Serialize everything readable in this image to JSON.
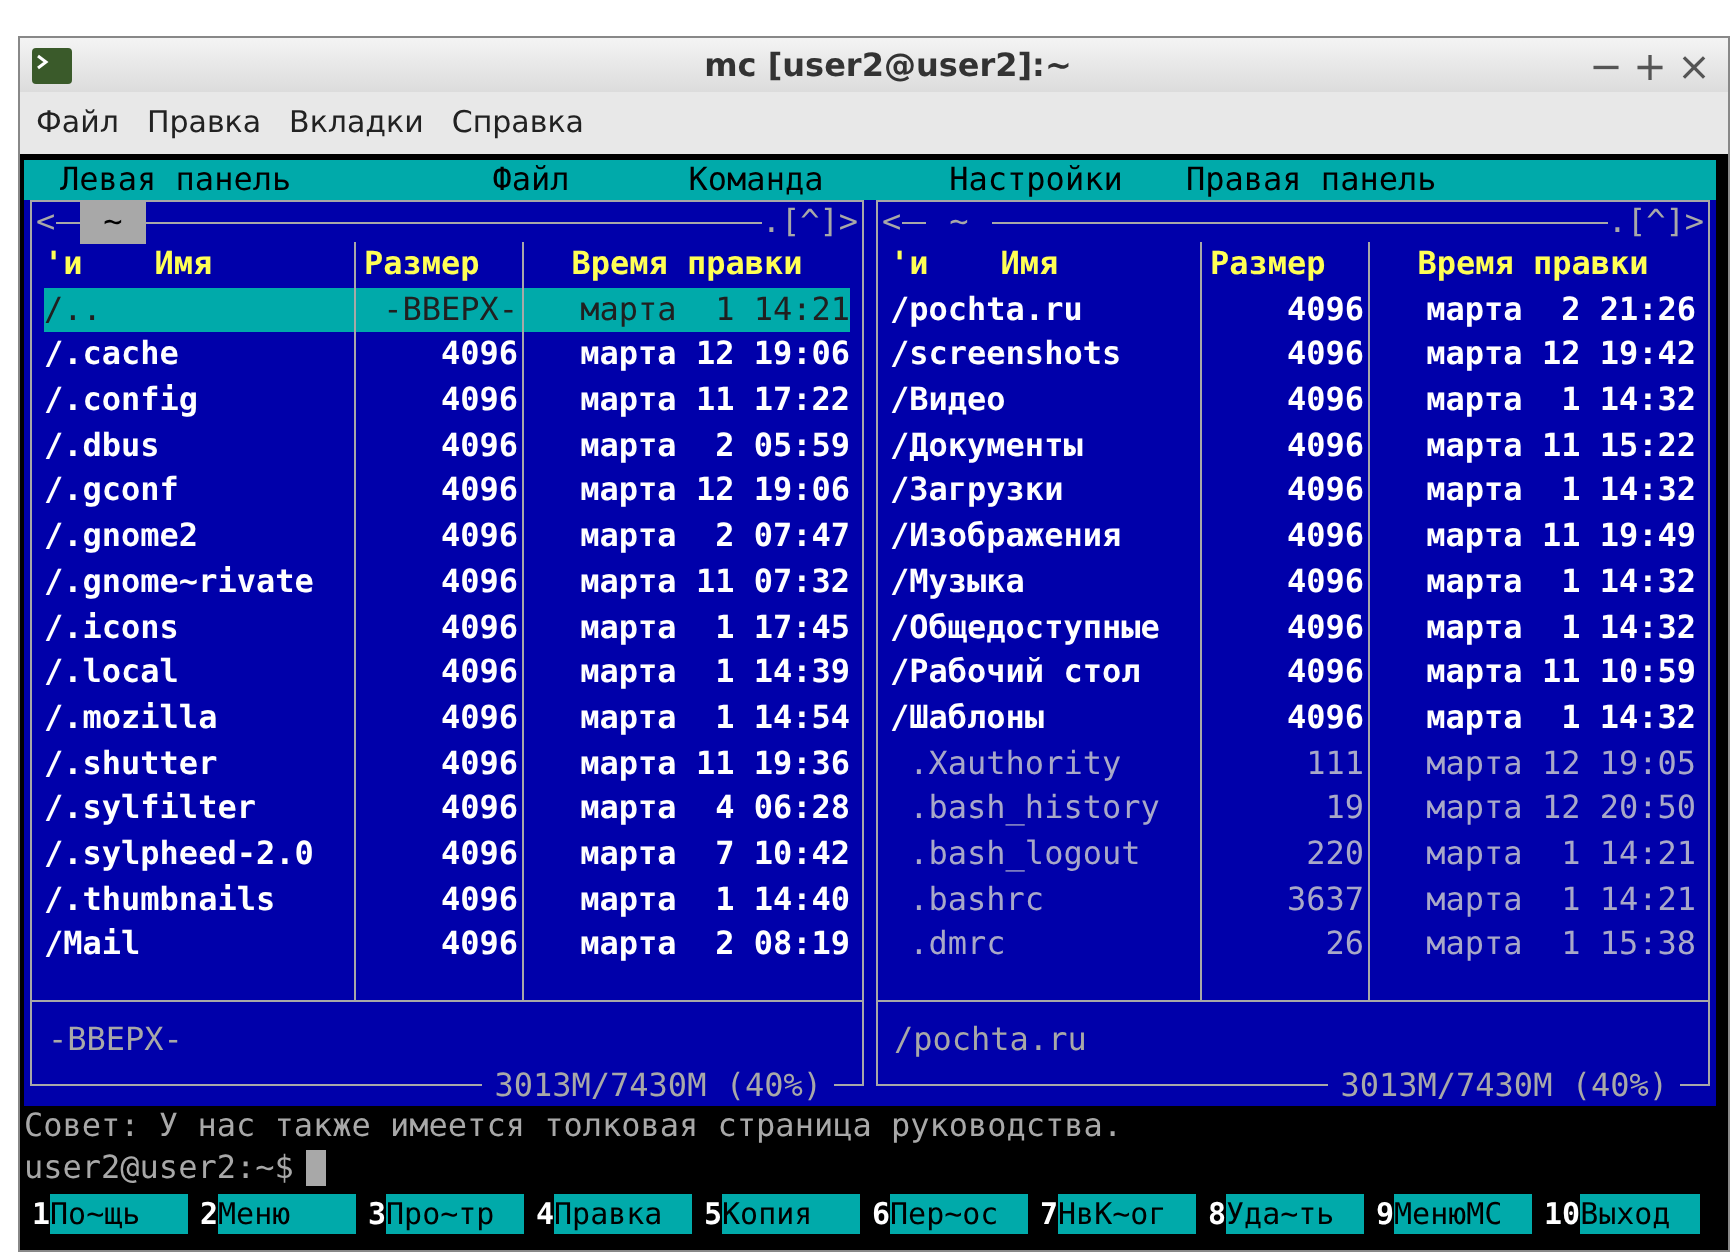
{
  "window": {
    "title": "mc [user2@user2]:~",
    "controls": [
      "−",
      "+",
      "×"
    ]
  },
  "menu": [
    "Файл",
    "Правка",
    "Вкладки",
    "Справка"
  ],
  "mc_menu": [
    "Левая панель",
    "Файл",
    "Команда",
    "Настройки",
    "Правая панель"
  ],
  "panels": [
    {
      "active": true,
      "left_mark": "<",
      "dir": "~",
      "history": ".[^]>",
      "columns": [
        "'и",
        "Имя",
        "Размер",
        "Время правки"
      ],
      "rows": [
        {
          "kind": "up",
          "name": "/..",
          "size": "-ВВЕРХ-",
          "time": "марта  1 14:21",
          "selected": true
        },
        {
          "kind": "dir",
          "name": "/.cache",
          "size": "4096",
          "time": "марта 12 19:06",
          "selected": false
        },
        {
          "kind": "dir",
          "name": "/.config",
          "size": "4096",
          "time": "марта 11 17:22",
          "selected": false
        },
        {
          "kind": "dir",
          "name": "/.dbus",
          "size": "4096",
          "time": "марта  2 05:59",
          "selected": false
        },
        {
          "kind": "dir",
          "name": "/.gconf",
          "size": "4096",
          "time": "марта 12 19:06",
          "selected": false
        },
        {
          "kind": "dir",
          "name": "/.gnome2",
          "size": "4096",
          "time": "марта  2 07:47",
          "selected": false
        },
        {
          "kind": "dir",
          "name": "/.gnome~rivate",
          "size": "4096",
          "time": "марта 11 07:32",
          "selected": false
        },
        {
          "kind": "dir",
          "name": "/.icons",
          "size": "4096",
          "time": "марта  1 17:45",
          "selected": false
        },
        {
          "kind": "dir",
          "name": "/.local",
          "size": "4096",
          "time": "марта  1 14:39",
          "selected": false
        },
        {
          "kind": "dir",
          "name": "/.mozilla",
          "size": "4096",
          "time": "марта  1 14:54",
          "selected": false
        },
        {
          "kind": "dir",
          "name": "/.shutter",
          "size": "4096",
          "time": "марта 11 19:36",
          "selected": false
        },
        {
          "kind": "dir",
          "name": "/.sylfilter",
          "size": "4096",
          "time": "марта  4 06:28",
          "selected": false
        },
        {
          "kind": "dir",
          "name": "/.sylpheed-2.0",
          "size": "4096",
          "time": "марта  7 10:42",
          "selected": false
        },
        {
          "kind": "dir",
          "name": "/.thumbnails",
          "size": "4096",
          "time": "марта  1 14:40",
          "selected": false
        },
        {
          "kind": "dir",
          "name": "/Mail",
          "size": "4096",
          "time": "марта  2 08:19",
          "selected": false
        }
      ],
      "mini_status": "-ВВЕРХ-",
      "free_space": "3013M/7430M (40%)"
    },
    {
      "active": false,
      "left_mark": "<",
      "dir": "~",
      "history": ".[^]>",
      "columns": [
        "'и",
        "Имя",
        "Размер",
        "Время правки"
      ],
      "rows": [
        {
          "kind": "dir",
          "name": "/pochta.ru",
          "size": "4096",
          "time": "марта  2 21:26",
          "selected": false
        },
        {
          "kind": "dir",
          "name": "/screenshots",
          "size": "4096",
          "time": "марта 12 19:42",
          "selected": false
        },
        {
          "kind": "dir",
          "name": "/Видео",
          "size": "4096",
          "time": "марта  1 14:32",
          "selected": false
        },
        {
          "kind": "dir",
          "name": "/Документы",
          "size": "4096",
          "time": "марта 11 15:22",
          "selected": false
        },
        {
          "kind": "dir",
          "name": "/Загрузки",
          "size": "4096",
          "time": "марта  1 14:32",
          "selected": false
        },
        {
          "kind": "dir",
          "name": "/Изображения",
          "size": "4096",
          "time": "марта 11 19:49",
          "selected": false
        },
        {
          "kind": "dir",
          "name": "/Музыка",
          "size": "4096",
          "time": "марта  1 14:32",
          "selected": false
        },
        {
          "kind": "dir",
          "name": "/Общедоступные",
          "size": "4096",
          "time": "марта  1 14:32",
          "selected": false
        },
        {
          "kind": "dir",
          "name": "/Рабочий стол",
          "size": "4096",
          "time": "марта 11 10:59",
          "selected": false
        },
        {
          "kind": "dir",
          "name": "/Шаблоны",
          "size": "4096",
          "time": "марта  1 14:32",
          "selected": false
        },
        {
          "kind": "file",
          "name": " .Xauthority",
          "size": "111",
          "time": "марта 12 19:05",
          "selected": false
        },
        {
          "kind": "file",
          "name": " .bash_history",
          "size": "19",
          "time": "марта 12 20:50",
          "selected": false
        },
        {
          "kind": "file",
          "name": " .bash_logout",
          "size": "220",
          "time": "марта  1 14:21",
          "selected": false
        },
        {
          "kind": "file",
          "name": " .bashrc",
          "size": "3637",
          "time": "марта  1 14:21",
          "selected": false
        },
        {
          "kind": "file",
          "name": " .dmrc",
          "size": "26",
          "time": "марта  1 15:38",
          "selected": false
        }
      ],
      "mini_status": "/pochta.ru",
      "free_space": "3013M/7430M (40%)"
    }
  ],
  "hint": "Совет: У нас также имеется толковая страница руководства.",
  "prompt": "user2@user2:~$",
  "keybar": [
    {
      "key": "1",
      "label": "По~щь"
    },
    {
      "key": "2",
      "label": "Меню"
    },
    {
      "key": "3",
      "label": "Про~тр"
    },
    {
      "key": "4",
      "label": "Правка"
    },
    {
      "key": "5",
      "label": "Копия"
    },
    {
      "key": "6",
      "label": "Пер~ос"
    },
    {
      "key": "7",
      "label": "НвК~ог"
    },
    {
      "key": "8",
      "label": "Уда~ть"
    },
    {
      "key": "9",
      "label": "МенюMC"
    },
    {
      "key": "10",
      "label": "Выход"
    }
  ]
}
